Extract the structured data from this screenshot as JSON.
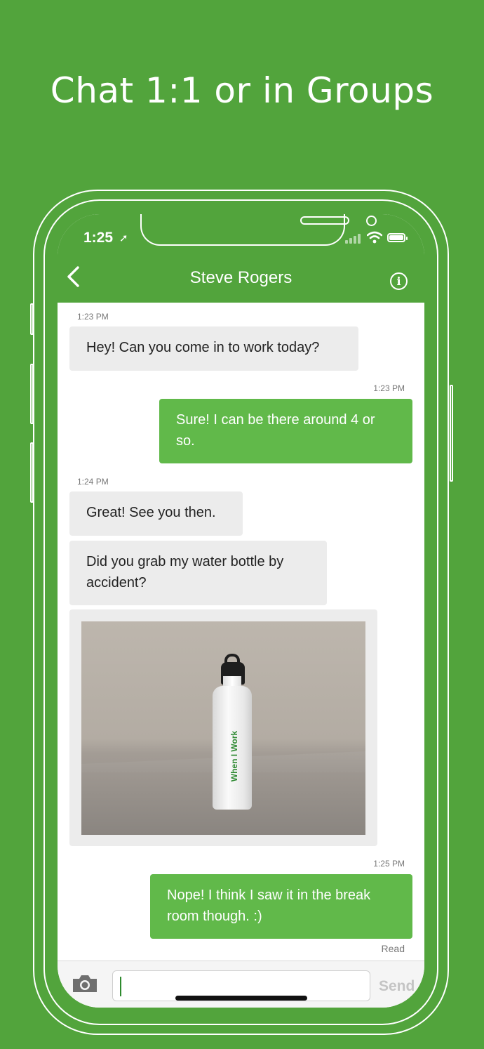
{
  "headline": "Chat 1:1 or in Groups",
  "status_bar": {
    "time": "1:25"
  },
  "nav": {
    "title": "Steve Rogers"
  },
  "messages": [
    {
      "time": "1:23 PM",
      "text": "Hey! Can you come in to work today?"
    },
    {
      "time": "1:23 PM",
      "text": "Sure! I can be there around 4 or so."
    },
    {
      "time": "1:24 PM",
      "text": "Great! See you then."
    },
    {
      "text": "Did you grab my water bottle by accident?"
    },
    {
      "image_brand_text": "When I Work"
    },
    {
      "time": "1:25 PM",
      "text": "Nope! I think I saw it in the break room though. :)"
    }
  ],
  "read_receipt": "Read",
  "composer": {
    "send_label": "Send",
    "input_value": ""
  },
  "colors": {
    "brand_green": "#52a43c",
    "outgoing_bubble": "#61b94a",
    "incoming_bubble": "#ececec"
  }
}
